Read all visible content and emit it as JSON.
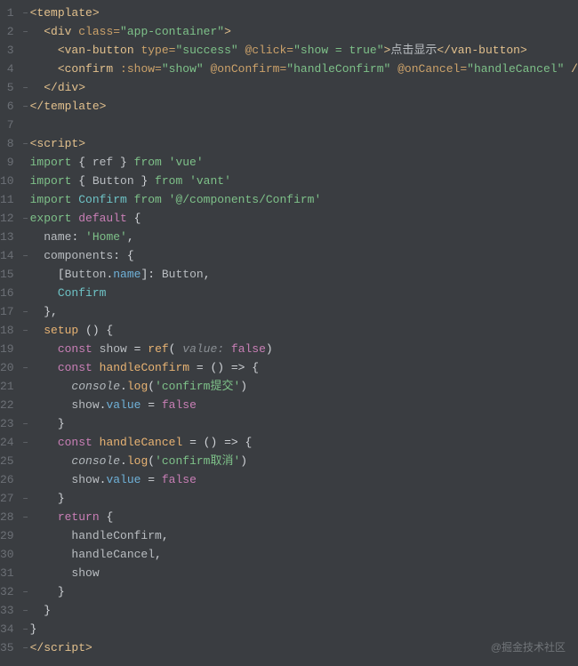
{
  "watermark": "@掘金技术社区",
  "lines": [
    {
      "n": 1,
      "f": "−",
      "tokens": [
        {
          "c": "ty",
          "t": "<template>"
        }
      ]
    },
    {
      "n": 2,
      "f": "−",
      "tokens": [
        {
          "c": "at",
          "t": "  "
        },
        {
          "c": "ty",
          "t": "<div "
        },
        {
          "c": "tc",
          "t": "class="
        },
        {
          "c": "str",
          "t": "\"app-container\""
        },
        {
          "c": "ty",
          "t": ">"
        }
      ]
    },
    {
      "n": 3,
      "f": "",
      "tokens": [
        {
          "c": "at",
          "t": "    "
        },
        {
          "c": "ty",
          "t": "<van-button "
        },
        {
          "c": "tc",
          "t": "type="
        },
        {
          "c": "str",
          "t": "\"success\""
        },
        {
          "c": "tc",
          "t": " @click="
        },
        {
          "c": "str",
          "t": "\"show = true\""
        },
        {
          "c": "ty",
          "t": ">"
        },
        {
          "c": "id",
          "t": "点击显示"
        },
        {
          "c": "ty",
          "t": "</van-button>"
        }
      ]
    },
    {
      "n": 4,
      "f": "",
      "tokens": [
        {
          "c": "at",
          "t": "    "
        },
        {
          "c": "ty",
          "t": "<confirm "
        },
        {
          "c": "tc",
          "t": ":show="
        },
        {
          "c": "str",
          "t": "\"show\""
        },
        {
          "c": "tc",
          "t": " @onConfirm="
        },
        {
          "c": "str",
          "t": "\"handleConfirm\""
        },
        {
          "c": "tc",
          "t": " @onCancel="
        },
        {
          "c": "str",
          "t": "\"handleCancel\""
        },
        {
          "c": "ty",
          "t": " />"
        }
      ]
    },
    {
      "n": 5,
      "f": "−",
      "tokens": [
        {
          "c": "at",
          "t": "  "
        },
        {
          "c": "ty",
          "t": "</div>"
        }
      ]
    },
    {
      "n": 6,
      "f": "−",
      "tokens": [
        {
          "c": "ty",
          "t": "</template>"
        }
      ]
    },
    {
      "n": 7,
      "f": "",
      "tokens": [
        {
          "c": "",
          "t": ""
        }
      ]
    },
    {
      "n": 8,
      "f": "−",
      "tokens": [
        {
          "c": "ty",
          "t": "<script>"
        }
      ]
    },
    {
      "n": 9,
      "f": "",
      "tokens": [
        {
          "c": "kw2",
          "t": "import "
        },
        {
          "c": "at",
          "t": "{ "
        },
        {
          "c": "id",
          "t": "ref"
        },
        {
          "c": "at",
          "t": " } "
        },
        {
          "c": "kw2",
          "t": "from "
        },
        {
          "c": "str",
          "t": "'vue'"
        }
      ]
    },
    {
      "n": 10,
      "f": "",
      "tokens": [
        {
          "c": "kw2",
          "t": "import "
        },
        {
          "c": "at",
          "t": "{ "
        },
        {
          "c": "id",
          "t": "Button"
        },
        {
          "c": "at",
          "t": " } "
        },
        {
          "c": "kw2",
          "t": "from "
        },
        {
          "c": "str",
          "t": "'vant'"
        }
      ]
    },
    {
      "n": 11,
      "f": "",
      "tokens": [
        {
          "c": "kw2",
          "t": "import "
        },
        {
          "c": "cyan",
          "t": "Confirm "
        },
        {
          "c": "kw2",
          "t": "from "
        },
        {
          "c": "str",
          "t": "'@/components/Confirm'"
        }
      ]
    },
    {
      "n": 12,
      "f": "−",
      "tokens": [
        {
          "c": "kw2",
          "t": "export "
        },
        {
          "c": "kw",
          "t": "default "
        },
        {
          "c": "at",
          "t": "{"
        }
      ]
    },
    {
      "n": 13,
      "f": "",
      "tokens": [
        {
          "c": "at",
          "t": "  "
        },
        {
          "c": "id",
          "t": "name"
        },
        {
          "c": "at",
          "t": ": "
        },
        {
          "c": "str",
          "t": "'Home'"
        },
        {
          "c": "at",
          "t": ","
        }
      ]
    },
    {
      "n": 14,
      "f": "−",
      "tokens": [
        {
          "c": "at",
          "t": "  "
        },
        {
          "c": "id",
          "t": "components"
        },
        {
          "c": "at",
          "t": ": {"
        }
      ]
    },
    {
      "n": 15,
      "f": "",
      "tokens": [
        {
          "c": "at",
          "t": "    ["
        },
        {
          "c": "id",
          "t": "Button"
        },
        {
          "c": "at",
          "t": "."
        },
        {
          "c": "blue",
          "t": "name"
        },
        {
          "c": "at",
          "t": "]: "
        },
        {
          "c": "id",
          "t": "Button"
        },
        {
          "c": "at",
          "t": ","
        }
      ]
    },
    {
      "n": 16,
      "f": "",
      "tokens": [
        {
          "c": "at",
          "t": "    "
        },
        {
          "c": "cyan",
          "t": "Confirm"
        }
      ]
    },
    {
      "n": 17,
      "f": "−",
      "tokens": [
        {
          "c": "at",
          "t": "  },"
        }
      ]
    },
    {
      "n": 18,
      "f": "−",
      "tokens": [
        {
          "c": "at",
          "t": "  "
        },
        {
          "c": "fn",
          "t": "setup "
        },
        {
          "c": "at",
          "t": "() {"
        }
      ]
    },
    {
      "n": 19,
      "f": "",
      "tokens": [
        {
          "c": "at",
          "t": "    "
        },
        {
          "c": "kw",
          "t": "const "
        },
        {
          "c": "id",
          "t": "show "
        },
        {
          "c": "at",
          "t": "= "
        },
        {
          "c": "fn",
          "t": "ref"
        },
        {
          "c": "at",
          "t": "( "
        },
        {
          "c": "param",
          "t": "value: "
        },
        {
          "c": "kw",
          "t": "false"
        },
        {
          "c": "at",
          "t": ")"
        }
      ]
    },
    {
      "n": 20,
      "f": "−",
      "tokens": [
        {
          "c": "at",
          "t": "    "
        },
        {
          "c": "kw",
          "t": "const "
        },
        {
          "c": "fn",
          "t": "handleConfirm "
        },
        {
          "c": "at",
          "t": "= () => {"
        }
      ]
    },
    {
      "n": 21,
      "f": "",
      "tokens": [
        {
          "c": "at",
          "t": "      "
        },
        {
          "c": "cm",
          "t": "console"
        },
        {
          "c": "at",
          "t": "."
        },
        {
          "c": "fn",
          "t": "log"
        },
        {
          "c": "at",
          "t": "("
        },
        {
          "c": "str",
          "t": "'confirm提交'"
        },
        {
          "c": "at",
          "t": ")"
        }
      ]
    },
    {
      "n": 22,
      "f": "",
      "tokens": [
        {
          "c": "at",
          "t": "      "
        },
        {
          "c": "id",
          "t": "show"
        },
        {
          "c": "at",
          "t": "."
        },
        {
          "c": "blue",
          "t": "value "
        },
        {
          "c": "at",
          "t": "= "
        },
        {
          "c": "kw",
          "t": "false"
        }
      ]
    },
    {
      "n": 23,
      "f": "−",
      "tokens": [
        {
          "c": "at",
          "t": "    }"
        }
      ]
    },
    {
      "n": 24,
      "f": "−",
      "tokens": [
        {
          "c": "at",
          "t": "    "
        },
        {
          "c": "kw",
          "t": "const "
        },
        {
          "c": "fn",
          "t": "handleCancel "
        },
        {
          "c": "at",
          "t": "= () => {"
        }
      ]
    },
    {
      "n": 25,
      "f": "",
      "tokens": [
        {
          "c": "at",
          "t": "      "
        },
        {
          "c": "cm",
          "t": "console"
        },
        {
          "c": "at",
          "t": "."
        },
        {
          "c": "fn",
          "t": "log"
        },
        {
          "c": "at",
          "t": "("
        },
        {
          "c": "str",
          "t": "'confirm取消'"
        },
        {
          "c": "at",
          "t": ")"
        }
      ]
    },
    {
      "n": 26,
      "f": "",
      "tokens": [
        {
          "c": "at",
          "t": "      "
        },
        {
          "c": "id",
          "t": "show"
        },
        {
          "c": "at",
          "t": "."
        },
        {
          "c": "blue",
          "t": "value "
        },
        {
          "c": "at",
          "t": "= "
        },
        {
          "c": "kw",
          "t": "false"
        }
      ]
    },
    {
      "n": 27,
      "f": "−",
      "tokens": [
        {
          "c": "at",
          "t": "    }"
        }
      ]
    },
    {
      "n": 28,
      "f": "−",
      "tokens": [
        {
          "c": "at",
          "t": "    "
        },
        {
          "c": "kw",
          "t": "return "
        },
        {
          "c": "at",
          "t": "{"
        }
      ]
    },
    {
      "n": 29,
      "f": "",
      "tokens": [
        {
          "c": "at",
          "t": "      "
        },
        {
          "c": "id",
          "t": "handleConfirm"
        },
        {
          "c": "at",
          "t": ","
        }
      ]
    },
    {
      "n": 30,
      "f": "",
      "tokens": [
        {
          "c": "at",
          "t": "      "
        },
        {
          "c": "id",
          "t": "handleCancel"
        },
        {
          "c": "at",
          "t": ","
        }
      ]
    },
    {
      "n": 31,
      "f": "",
      "tokens": [
        {
          "c": "at",
          "t": "      "
        },
        {
          "c": "id",
          "t": "show"
        }
      ]
    },
    {
      "n": 32,
      "f": "−",
      "tokens": [
        {
          "c": "at",
          "t": "    }"
        }
      ]
    },
    {
      "n": 33,
      "f": "−",
      "tokens": [
        {
          "c": "at",
          "t": "  }"
        }
      ]
    },
    {
      "n": 34,
      "f": "−",
      "tokens": [
        {
          "c": "at",
          "t": "}"
        }
      ]
    },
    {
      "n": 35,
      "f": "−",
      "tokens": [
        {
          "c": "ty",
          "t": "</scr"
        },
        {
          "c": "ty",
          "t": "ipt>"
        }
      ]
    }
  ]
}
